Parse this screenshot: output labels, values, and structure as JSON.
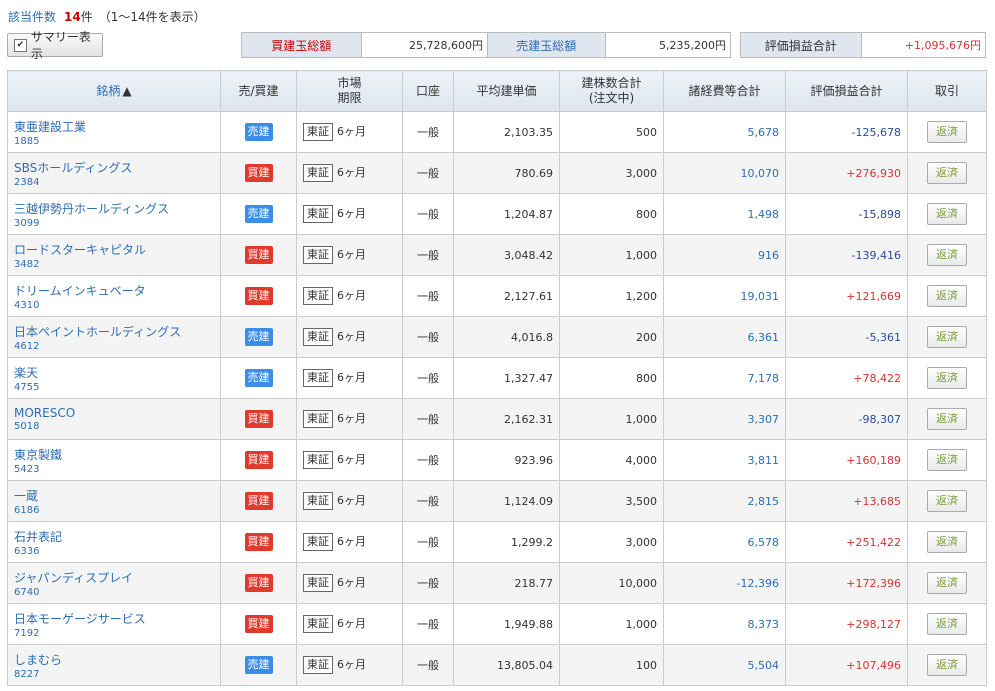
{
  "header": {
    "count_label": "該当件数",
    "count_value": "14",
    "count_unit": "件",
    "range_text": "（1〜14件を表示）"
  },
  "summary_toggle": {
    "label": "サマリー表示",
    "checked": true
  },
  "totals": {
    "buy_label": "買建玉総額",
    "buy_value": "25,728,600円",
    "sell_label": "売建玉総額",
    "sell_value": "5,235,200円",
    "pl_label": "評価損益合計",
    "pl_value": "+1,095,676円"
  },
  "columns": {
    "name": "銘柄",
    "sort_indicator": "▲",
    "side": "売/買建",
    "market_1": "市場",
    "market_2": "期限",
    "account": "口座",
    "avg_price": "平均建単価",
    "qty_1": "建株数合計",
    "qty_2": "(注文中)",
    "fees": "諸経費等合計",
    "pl": "評価損益合計",
    "trade": "取引"
  },
  "rows": [
    {
      "name": "東亜建設工業",
      "code": "1885",
      "side": "売建",
      "side_type": "sell",
      "market": "東証",
      "term": "6ヶ月",
      "account": "一般",
      "avg": "2,103.35",
      "qty": "500",
      "fees": "5,678",
      "pl": "-125,678",
      "pl_sign": "neg",
      "action": "返済"
    },
    {
      "name": "SBSホールディングス",
      "code": "2384",
      "side": "買建",
      "side_type": "buy",
      "market": "東証",
      "term": "6ヶ月",
      "account": "一般",
      "avg": "780.69",
      "qty": "3,000",
      "fees": "10,070",
      "pl": "+276,930",
      "pl_sign": "pos",
      "action": "返済"
    },
    {
      "name": "三越伊勢丹ホールディングス",
      "code": "3099",
      "side": "売建",
      "side_type": "sell",
      "market": "東証",
      "term": "6ヶ月",
      "account": "一般",
      "avg": "1,204.87",
      "qty": "800",
      "fees": "1,498",
      "pl": "-15,898",
      "pl_sign": "neg",
      "action": "返済"
    },
    {
      "name": "ロードスターキャピタル",
      "code": "3482",
      "side": "買建",
      "side_type": "buy",
      "market": "東証",
      "term": "6ヶ月",
      "account": "一般",
      "avg": "3,048.42",
      "qty": "1,000",
      "fees": "916",
      "pl": "-139,416",
      "pl_sign": "neg",
      "action": "返済"
    },
    {
      "name": "ドリームインキュベータ",
      "code": "4310",
      "side": "買建",
      "side_type": "buy",
      "market": "東証",
      "term": "6ヶ月",
      "account": "一般",
      "avg": "2,127.61",
      "qty": "1,200",
      "fees": "19,031",
      "pl": "+121,669",
      "pl_sign": "pos",
      "action": "返済"
    },
    {
      "name": "日本ペイントホールディングス",
      "code": "4612",
      "side": "売建",
      "side_type": "sell",
      "market": "東証",
      "term": "6ヶ月",
      "account": "一般",
      "avg": "4,016.8",
      "qty": "200",
      "fees": "6,361",
      "pl": "-5,361",
      "pl_sign": "neg",
      "action": "返済"
    },
    {
      "name": "楽天",
      "code": "4755",
      "side": "売建",
      "side_type": "sell",
      "market": "東証",
      "term": "6ヶ月",
      "account": "一般",
      "avg": "1,327.47",
      "qty": "800",
      "fees": "7,178",
      "pl": "+78,422",
      "pl_sign": "pos",
      "action": "返済"
    },
    {
      "name": "MORESCO",
      "code": "5018",
      "side": "買建",
      "side_type": "buy",
      "market": "東証",
      "term": "6ヶ月",
      "account": "一般",
      "avg": "2,162.31",
      "qty": "1,000",
      "fees": "3,307",
      "pl": "-98,307",
      "pl_sign": "neg",
      "action": "返済"
    },
    {
      "name": "東京製鐵",
      "code": "5423",
      "side": "買建",
      "side_type": "buy",
      "market": "東証",
      "term": "6ヶ月",
      "account": "一般",
      "avg": "923.96",
      "qty": "4,000",
      "fees": "3,811",
      "pl": "+160,189",
      "pl_sign": "pos",
      "action": "返済"
    },
    {
      "name": "一蔵",
      "code": "6186",
      "side": "買建",
      "side_type": "buy",
      "market": "東証",
      "term": "6ヶ月",
      "account": "一般",
      "avg": "1,124.09",
      "qty": "3,500",
      "fees": "2,815",
      "pl": "+13,685",
      "pl_sign": "pos",
      "action": "返済"
    },
    {
      "name": "石井表記",
      "code": "6336",
      "side": "買建",
      "side_type": "buy",
      "market": "東証",
      "term": "6ヶ月",
      "account": "一般",
      "avg": "1,299.2",
      "qty": "3,000",
      "fees": "6,578",
      "pl": "+251,422",
      "pl_sign": "pos",
      "action": "返済"
    },
    {
      "name": "ジャパンディスプレイ",
      "code": "6740",
      "side": "買建",
      "side_type": "buy",
      "market": "東証",
      "term": "6ヶ月",
      "account": "一般",
      "avg": "218.77",
      "qty": "10,000",
      "fees": "-12,396",
      "pl": "+172,396",
      "pl_sign": "pos",
      "action": "返済"
    },
    {
      "name": "日本モーゲージサービス",
      "code": "7192",
      "side": "買建",
      "side_type": "buy",
      "market": "東証",
      "term": "6ヶ月",
      "account": "一般",
      "avg": "1,949.88",
      "qty": "1,000",
      "fees": "8,373",
      "pl": "+298,127",
      "pl_sign": "pos",
      "action": "返済"
    },
    {
      "name": "しまむら",
      "code": "8227",
      "side": "売建",
      "side_type": "sell",
      "market": "東証",
      "term": "6ヶ月",
      "account": "一般",
      "avg": "13,805.04",
      "qty": "100",
      "fees": "5,504",
      "pl": "+107,496",
      "pl_sign": "pos",
      "action": "返済"
    }
  ]
}
